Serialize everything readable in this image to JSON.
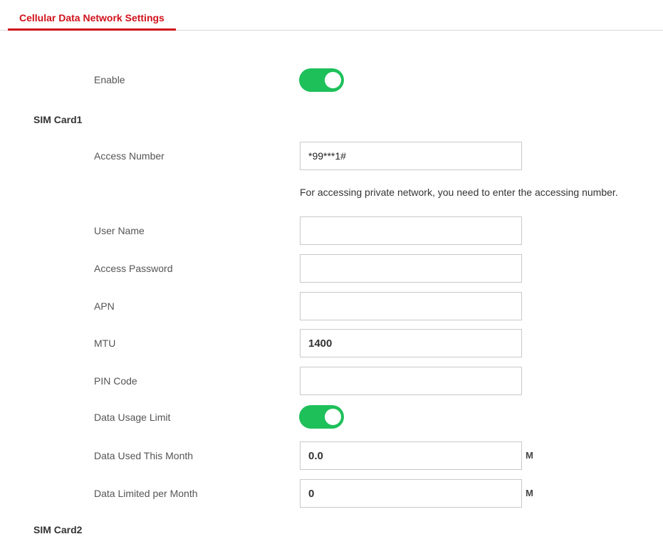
{
  "tab": {
    "label": "Cellular Data Network Settings"
  },
  "enable": {
    "label": "Enable",
    "on": true
  },
  "sim1": {
    "title": "SIM Card1",
    "access_number": {
      "label": "Access Number",
      "value": "*99***1#"
    },
    "hint": "For accessing private network, you need to enter the accessing number.",
    "user_name": {
      "label": "User Name",
      "value": ""
    },
    "access_password": {
      "label": "Access Password",
      "value": ""
    },
    "apn": {
      "label": "APN",
      "value": ""
    },
    "mtu": {
      "label": "MTU",
      "value": "1400"
    },
    "pin_code": {
      "label": "PIN Code",
      "value": ""
    },
    "data_usage_limit": {
      "label": "Data Usage Limit",
      "on": true
    },
    "data_used": {
      "label": "Data Used This Month",
      "value": "0.0",
      "unit": "M"
    },
    "data_limit": {
      "label": "Data Limited per Month",
      "value": "0",
      "unit": "M"
    }
  },
  "sim2": {
    "title": "SIM Card2"
  },
  "colors": {
    "accent": "#d0121b",
    "toggle_on": "#1ec05a"
  }
}
